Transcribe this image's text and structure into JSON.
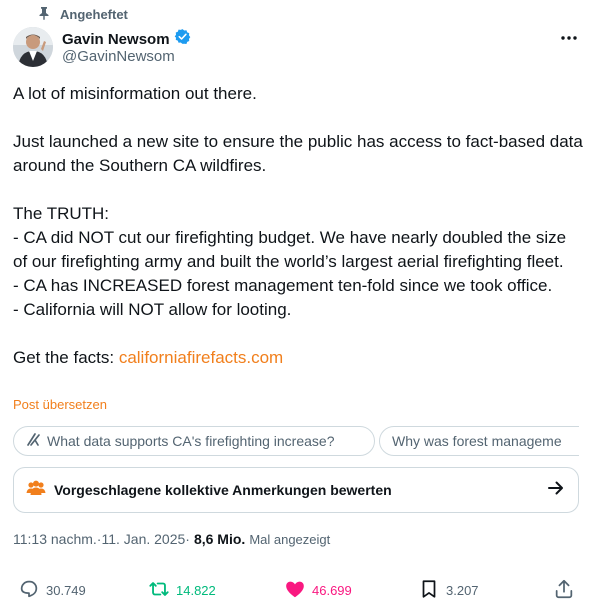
{
  "pinned_label": "Angeheftet",
  "author": {
    "name": "Gavin Newsom",
    "handle": "@GavinNewsom"
  },
  "tweet": {
    "line1": "A lot of misinformation out there.",
    "line2": "Just launched a new site to ensure the public has access to fact-based data around the Southern CA wildfires.",
    "line3": "The TRUTH:",
    "line4": "- CA did NOT cut our firefighting budget. We have nearly doubled the size of our firefighting army and built the world’s largest aerial firefighting fleet.",
    "line5": "- CA has INCREASED forest management ten-fold since we took office.",
    "line6": "- California will NOT allow for looting.",
    "facts_prefix": "Get the facts: ",
    "facts_link": "californiafirefacts.com"
  },
  "translate_label": "Post übersetzen",
  "suggestions": [
    "What data supports CA's firefighting increase?",
    "Why was forest manageme"
  ],
  "community_notes_label": "Vorgeschlagene kollektive Anmerkungen bewerten",
  "meta": {
    "time": "11:13 nachm.",
    "sep1": " · ",
    "date": "11. Jan. 2025",
    "sep2": " · ",
    "views": "8,6 Mio.",
    "views_label": "Mal angezeigt"
  },
  "actions": {
    "replies": "30.749",
    "reposts": "14.822",
    "likes": "46.699",
    "bookmarks": "3.207"
  },
  "colors": {
    "repost": "#00ba7c",
    "like": "#f91880",
    "link": "#f17f1c",
    "verified": "#1d9bf0",
    "muted": "#536471"
  }
}
